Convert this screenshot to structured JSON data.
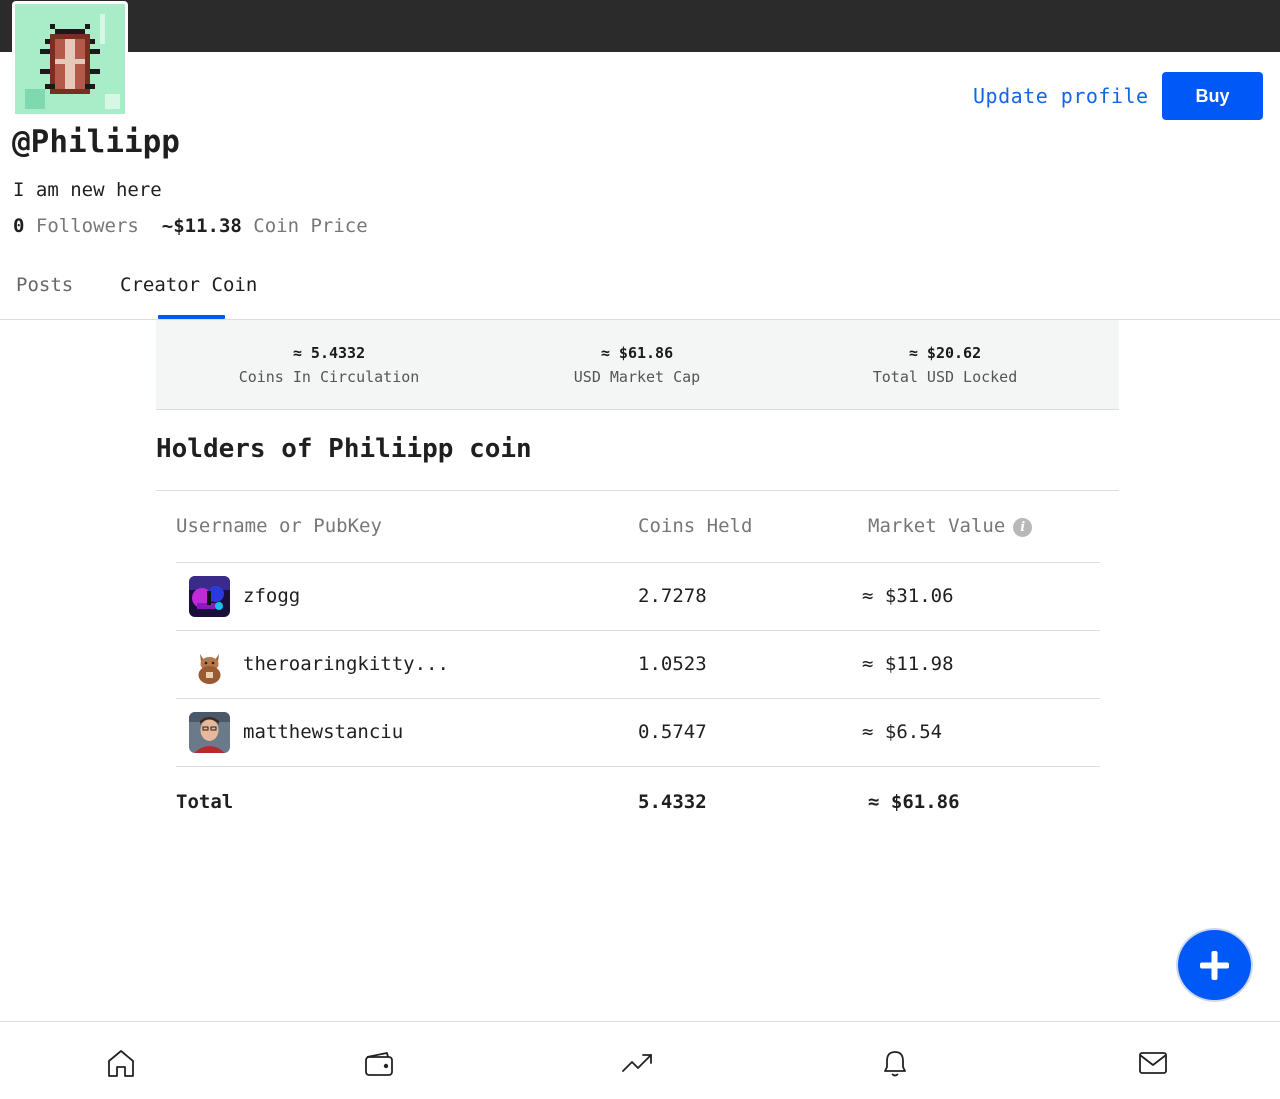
{
  "profile": {
    "username": "@Philiipp",
    "bio": "I am new here",
    "followers_count": "0",
    "followers_label": "Followers",
    "coin_price": "~$11.38",
    "coin_price_label": "Coin Price"
  },
  "actions": {
    "update_profile": "Update profile",
    "buy": "Buy"
  },
  "tabs": [
    {
      "label": "Posts",
      "active": false
    },
    {
      "label": "Creator Coin",
      "active": true
    }
  ],
  "summary": [
    {
      "value": "≈ 5.4332",
      "label": "Coins In Circulation"
    },
    {
      "value": "≈ $61.86",
      "label": "USD Market Cap"
    },
    {
      "value": "≈ $20.62",
      "label": "Total USD Locked"
    }
  ],
  "holders": {
    "title": "Holders of Philiipp coin",
    "columns": [
      "Username or PubKey",
      "Coins Held",
      "Market Value"
    ],
    "rows": [
      {
        "name": "zfogg",
        "coins": "2.7278",
        "value": "≈ $31.06"
      },
      {
        "name": "theroaringkitty...",
        "coins": "1.0523",
        "value": "≈ $11.98"
      },
      {
        "name": "matthewstanciu",
        "coins": "0.5747",
        "value": "≈ $6.54"
      }
    ],
    "total": {
      "label": "Total",
      "coins": "5.4332",
      "value": "≈ $61.86"
    }
  },
  "nav": [
    "home-icon",
    "wallet-icon",
    "trending-icon",
    "bell-icon",
    "mail-icon"
  ],
  "colors": {
    "accent": "#0059f7",
    "topbar": "#2b2b2b"
  }
}
